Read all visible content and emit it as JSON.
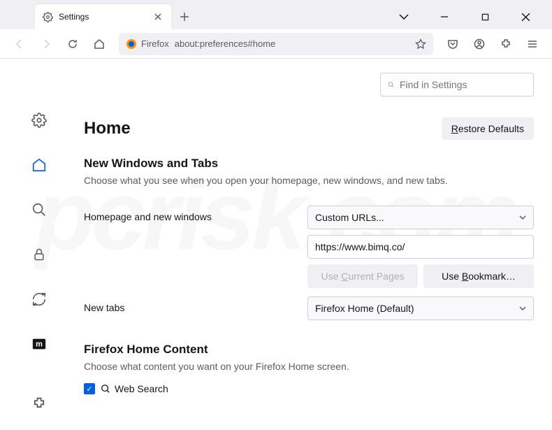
{
  "tab": {
    "title": "Settings"
  },
  "urlbar": {
    "label": "Firefox",
    "url": "about:preferences#home"
  },
  "search": {
    "placeholder": "Find in Settings"
  },
  "page": {
    "title": "Home",
    "restore": "Restore Defaults"
  },
  "section1": {
    "title": "New Windows and Tabs",
    "desc": "Choose what you see when you open your homepage, new windows, and new tabs."
  },
  "homepage": {
    "label": "Homepage and new windows",
    "select": "Custom URLs...",
    "url": "https://www.bimq.co/",
    "useCurrent": "Use Current Pages",
    "useBookmark": "Use Bookmark…"
  },
  "newtabs": {
    "label": "New tabs",
    "select": "Firefox Home (Default)"
  },
  "section2": {
    "title": "Firefox Home Content",
    "desc": "Choose what content you want on your Firefox Home screen."
  },
  "websearch": {
    "label": "Web Search"
  }
}
